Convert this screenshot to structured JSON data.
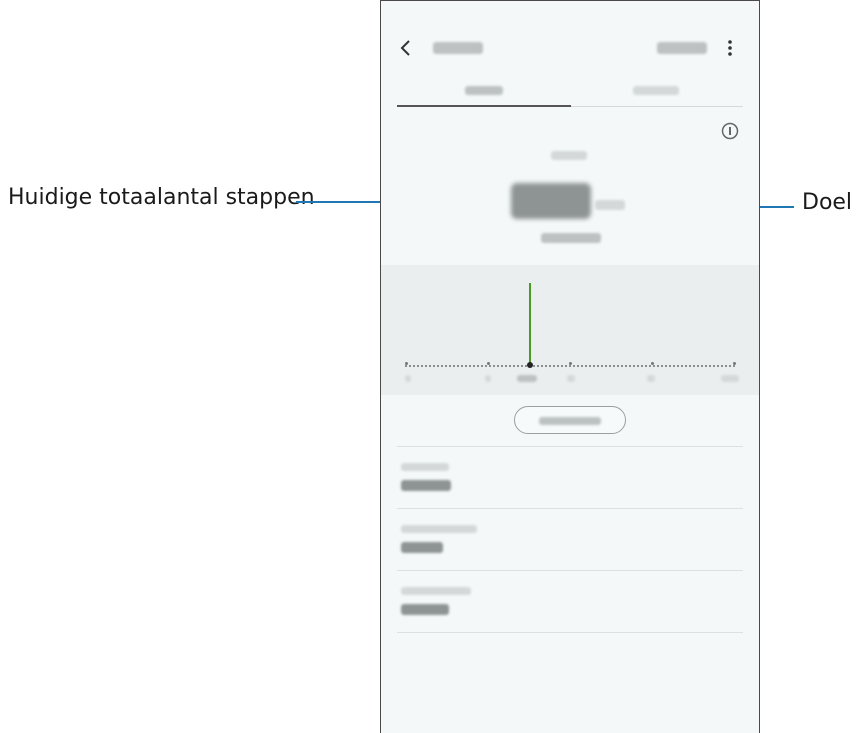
{
  "callouts": {
    "left": "Huidige totaalantal stappen",
    "right": "Doel"
  },
  "colors": {
    "leader": "#1f78b4",
    "chart_bar": "#4a9a28"
  }
}
